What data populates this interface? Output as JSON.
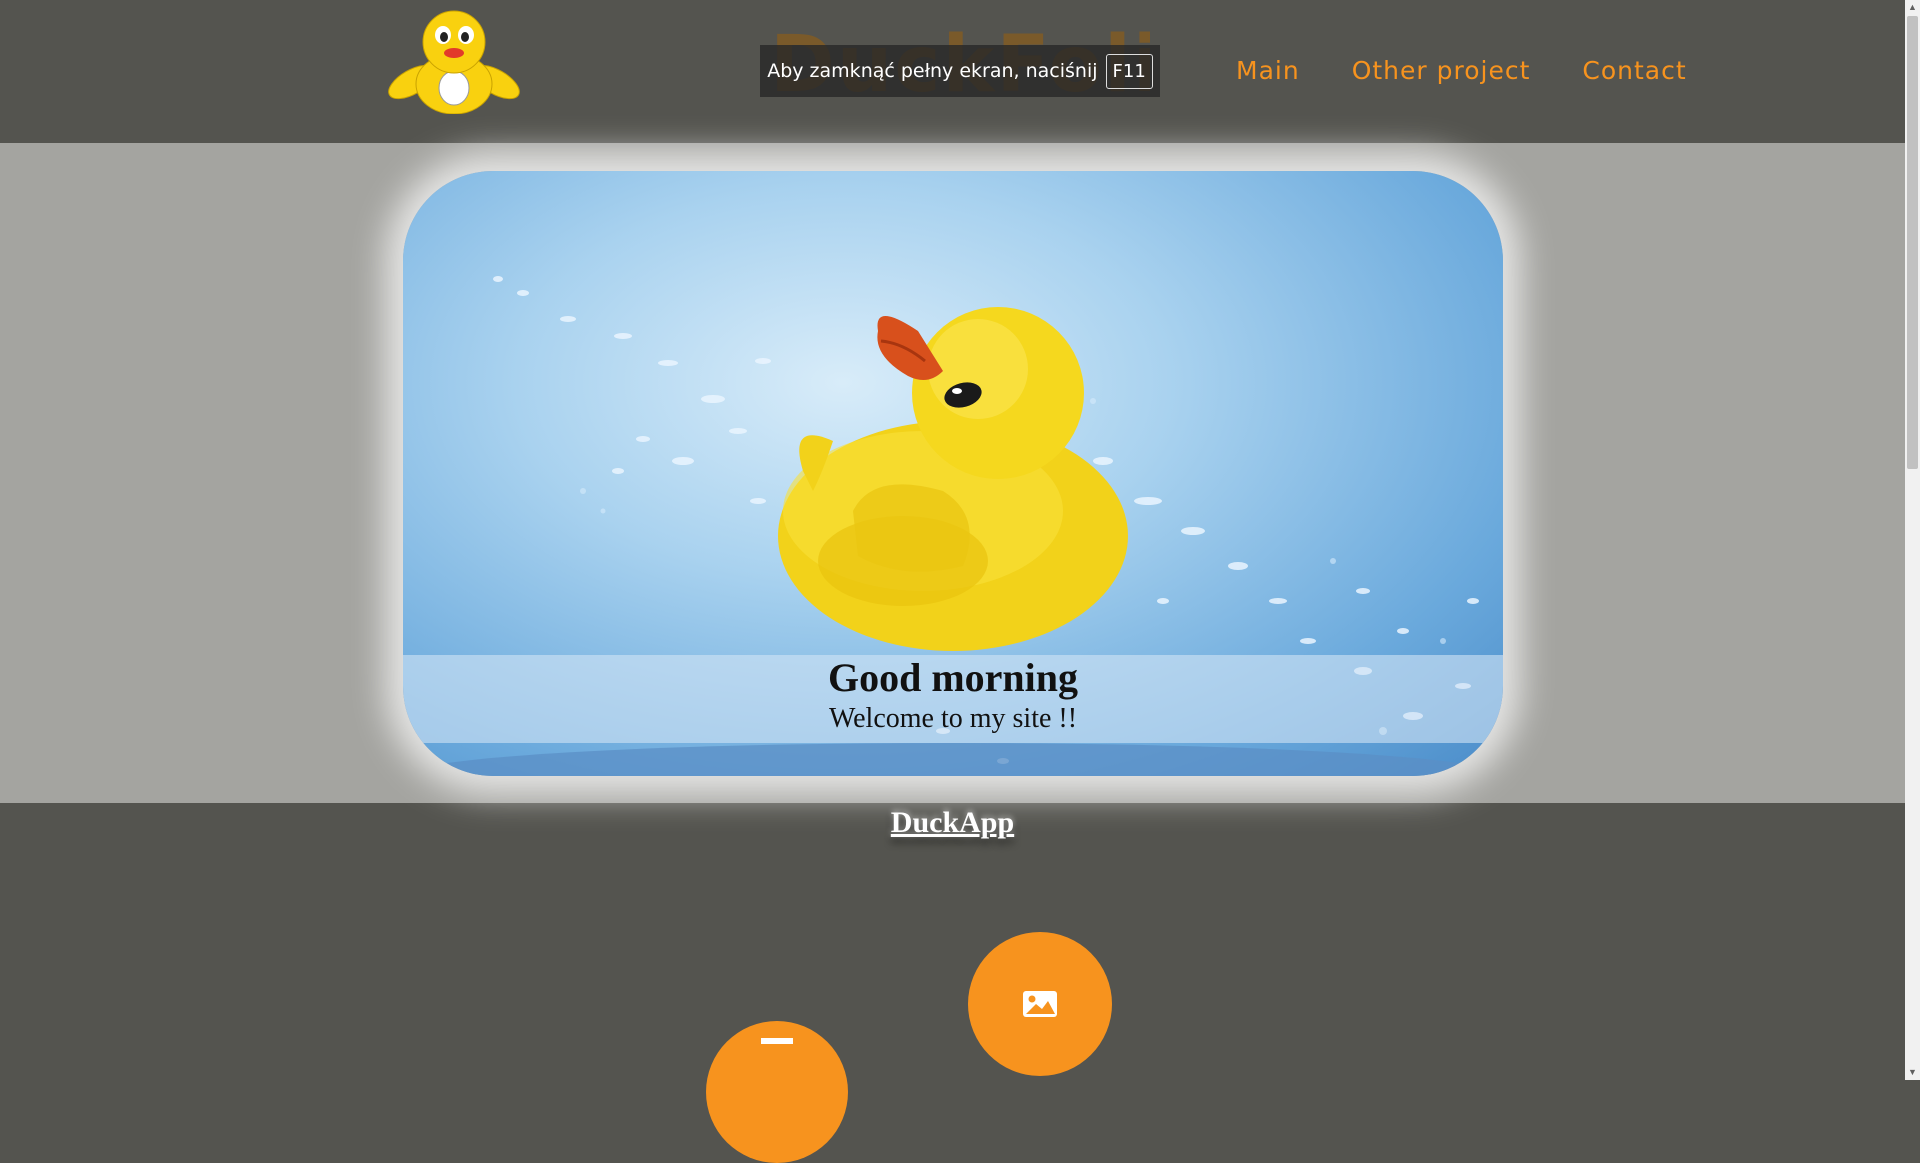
{
  "header": {
    "brand": "DuckFolio",
    "fullscreen_tip": {
      "text": "Aby zamknąć pełny ekran, naciśnij",
      "key": "F11"
    },
    "nav": [
      "Main",
      "Other project",
      "Contact"
    ]
  },
  "hero": {
    "title": "Good morning",
    "subtitle": "Welcome to my site !!"
  },
  "section": {
    "title": "DuckApp"
  },
  "colors": {
    "accent": "#f7931e",
    "background": "#54544f",
    "band": "#a4a4a0"
  },
  "icons": {
    "logo": "duck-logo-icon",
    "circle_1": "calendar-icon",
    "circle_2": "image-icon"
  }
}
